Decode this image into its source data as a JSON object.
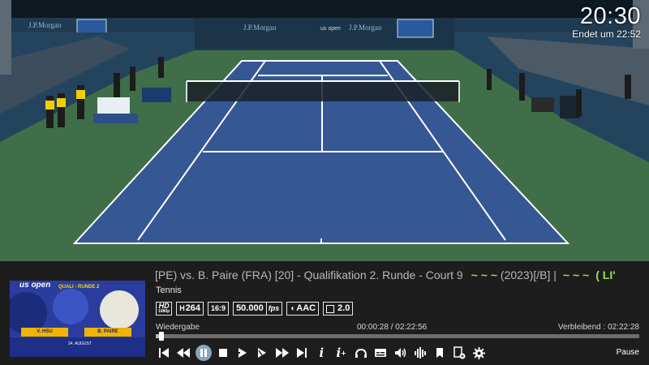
{
  "clock": {
    "time": "20:30",
    "end_text": "Endet um 22:52"
  },
  "video": {
    "banners": [
      "J.P.Morgan",
      "J.P.Morgan",
      "J.P.Morgan"
    ],
    "court_colors": {
      "inner": "#355793",
      "outer": "#3f6e49",
      "stands": "#24445e"
    }
  },
  "info": {
    "title_scroll": "[PE) vs. B. Paire (FRA) [20] - Qualifikation 2. Runde - Court 9",
    "title_tilde": "~ ~ ~",
    "title_mid": "(2023)[/B] |",
    "title_tilde2": "~ ~ ~",
    "title_tail": "( LI'",
    "genre": "Tennis",
    "badges": {
      "hd": "HD",
      "hd_sub": "1080p",
      "codec_prefix": "H",
      "codec": "264",
      "ratio": "16:9",
      "fps_value": "50.000",
      "fps_unit": "fps",
      "audio": "AAC",
      "channels": "2.0"
    },
    "playback_label": "Wiedergabe",
    "elapsed": "00:00:28 / 02:22:56",
    "remaining": "Verbleibend : 02:22:28",
    "progress_fraction": 0.0033,
    "state_label": "Pause"
  },
  "thumbnail": {
    "logo": "us open",
    "tag": "QUALI - RUNDE 2",
    "player1": "V. HSU",
    "player2": "B. PAIRE",
    "date": "24. AUGUST"
  },
  "controls": [
    "skip-previous-icon",
    "rewind-icon",
    "pause-icon",
    "stop-icon",
    "step-forward-icon",
    "slow-forward-icon",
    "fast-forward-icon",
    "skip-next-icon",
    "info-icon",
    "info-plus-icon",
    "audio-track-icon",
    "subtitles-icon",
    "volume-icon",
    "equalizer-icon",
    "bookmark-icon",
    "add-to-playlist-icon",
    "settings-icon"
  ],
  "colors": {
    "accent": "#9be34a",
    "active_button": "#8ba4b8",
    "bar_bg": "#1d1d1d"
  }
}
